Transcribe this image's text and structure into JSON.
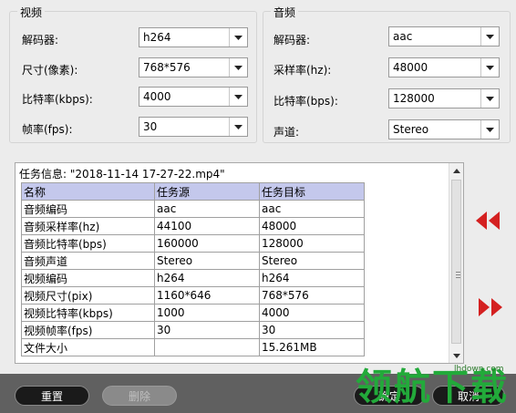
{
  "video": {
    "title": "视频",
    "decoder_label": "解码器:",
    "decoder_value": "h264",
    "size_label": "尺寸(像素):",
    "size_value": "768*576",
    "bitrate_label": "比特率(kbps):",
    "bitrate_value": "4000",
    "fps_label": "帧率(fps):",
    "fps_value": "30"
  },
  "audio": {
    "title": "音频",
    "decoder_label": "解码器:",
    "decoder_value": "aac",
    "samplerate_label": "采样率(hz):",
    "samplerate_value": "48000",
    "bitrate_label": "比特率(bps):",
    "bitrate_value": "128000",
    "channel_label": "声道:",
    "channel_value": "Stereo"
  },
  "task_info": {
    "title": "任务信息: \"2018-11-14 17-27-22.mp4\"",
    "headers": [
      "名称",
      "任务源",
      "任务目标"
    ],
    "rows": [
      [
        "音频编码",
        "aac",
        "aac"
      ],
      [
        "音频采样率(hz)",
        "44100",
        "48000"
      ],
      [
        "音频比特率(bps)",
        "160000",
        "128000"
      ],
      [
        "音频声道",
        "Stereo",
        "Stereo"
      ],
      [
        "视频编码",
        "h264",
        "h264"
      ],
      [
        "视频尺寸(pix)",
        "1160*646",
        "768*576"
      ],
      [
        "视频比特率(kbps)",
        "1000",
        "4000"
      ],
      [
        "视频帧率(fps)",
        "30",
        "30"
      ],
      [
        "文件大小",
        "",
        "15.261MB"
      ]
    ]
  },
  "buttons": {
    "reset": "重置",
    "delete": "删除",
    "confirm": "确定",
    "cancel": "取消"
  },
  "watermark": {
    "text": "领航下载",
    "url": "lhdown.com"
  },
  "colors": {
    "accent_red": "#d42020",
    "table_header": "#c4c8ec",
    "watermark_green": "#22aa3a"
  }
}
